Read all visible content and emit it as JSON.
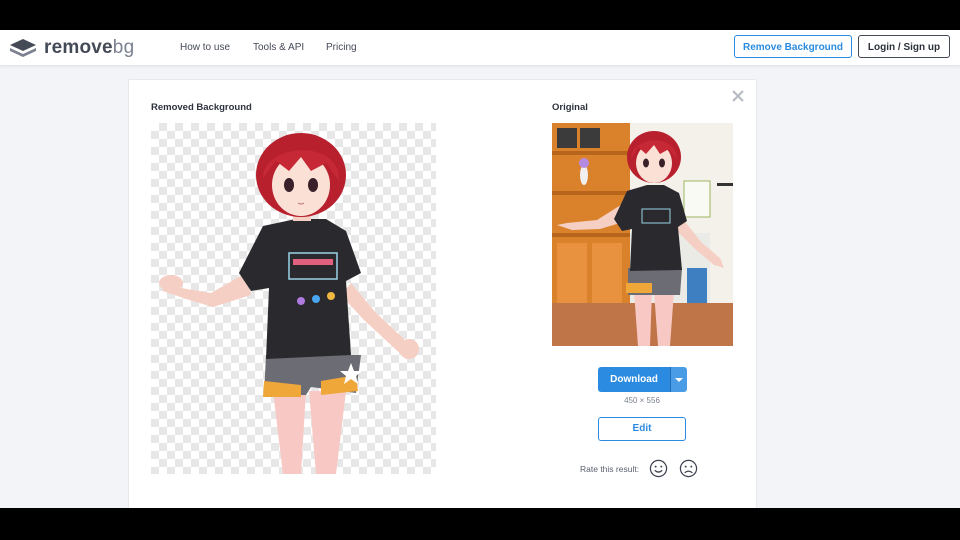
{
  "header": {
    "logo_text": "remove",
    "logo_suffix": "bg",
    "nav": [
      {
        "label": "How to use"
      },
      {
        "label": "Tools & API"
      },
      {
        "label": "Pricing"
      }
    ],
    "remove_background_button": "Remove Background",
    "login_button": "Login / Sign up"
  },
  "result": {
    "removed_title": "Removed Background",
    "original_title": "Original",
    "download_label": "Download",
    "dimensions": "450 × 556",
    "edit_label": "Edit",
    "rate_label": "Rate this result:"
  },
  "colors": {
    "accent": "#2b8be0",
    "text_dark": "#454a57",
    "page_bg": "#f3f4f7"
  },
  "icons": [
    "removebg-logo-icon",
    "close-icon",
    "caret-down-icon",
    "smiley-icon",
    "frown-icon"
  ]
}
